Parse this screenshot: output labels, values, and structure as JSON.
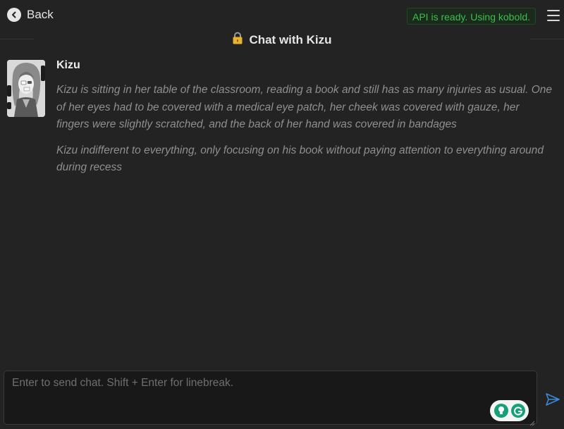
{
  "nav": {
    "back_label": "Back"
  },
  "api_status": {
    "text": "API is ready. Using kobold.",
    "color": "#3fbe4e"
  },
  "header": {
    "title": "Chat with Kizu",
    "lock_icon": "lock-icon"
  },
  "message": {
    "character_name": "Kizu",
    "paragraphs": [
      "Kizu is sitting in her table of the classroom, reading a book and still has as many injuries as usual. One of her eyes had to be covered with a medical eye patch, her cheek was covered with gauze, her fingers were slightly scratched, and the back of her hand was covered in bandages",
      "Kizu indifferent to everything, only focusing on his book without paying attention to everything around during recess"
    ]
  },
  "composer": {
    "placeholder": "Enter to send chat. Shift + Enter for linebreak.",
    "value": ""
  },
  "colors": {
    "accent": "#3b8ad9",
    "background": "#232323",
    "grammarly": "#15a078"
  }
}
